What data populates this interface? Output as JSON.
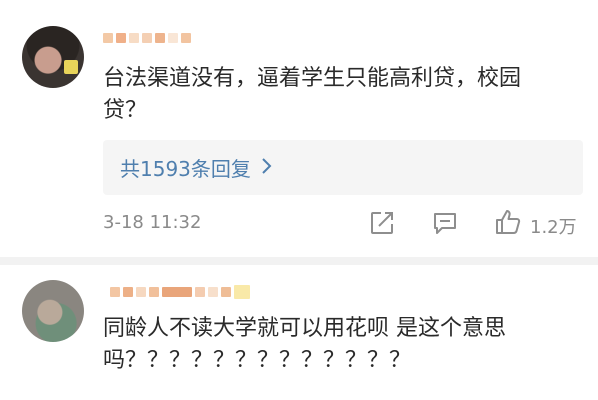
{
  "comments": [
    {
      "text": "台法渠道没有，逼着学生只能高利贷，校园\n贷？",
      "replies_label": "共1593条回复",
      "time": "3-18 11:32",
      "like_count": "1.2万"
    },
    {
      "text": "同龄人不读大学就可以用花呗 是这个意思\n吗？？？？？？？？？？？？？"
    }
  ],
  "icons": {
    "share": "share-icon",
    "comment": "comment-icon",
    "like": "thumbs-up-icon",
    "chevron": "chevron-right-icon"
  },
  "colors": {
    "link": "#4f7fae",
    "meta": "#8a8a8a",
    "reply_bg": "#f5f5f5"
  }
}
